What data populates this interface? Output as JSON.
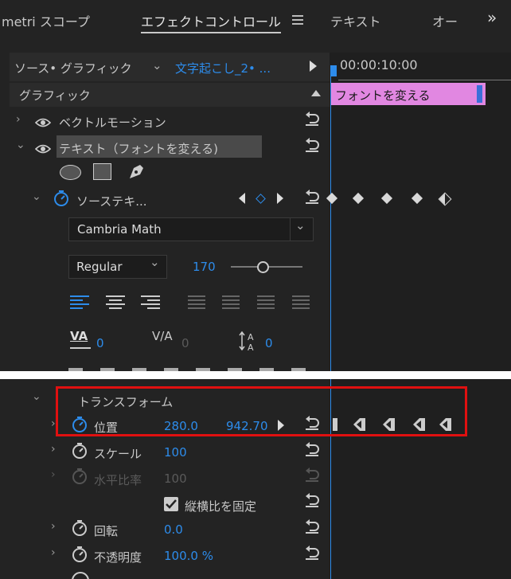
{
  "tabs": {
    "lumetri": "metri スコープ",
    "effect_controls": "エフェクトコントロール",
    "text": "テキスト",
    "other": "オー",
    "more": "»"
  },
  "source": {
    "label": "ソース• グラフィック",
    "clip": "文字起こし_2• ...",
    "timecode": "00:00:10:00",
    "clip_bar": "フォントを変える"
  },
  "section": {
    "graphic": "グラフィック"
  },
  "layers": {
    "vector_motion": "ベクトルモーション",
    "text_layer": "テキスト（フォントを変える)"
  },
  "source_text": {
    "label": "ソーステキ..."
  },
  "font": {
    "family": "Cambria Math",
    "style": "Regular",
    "size": "170"
  },
  "tracking": {
    "kerning": "0",
    "tracking": "0",
    "leading": "0",
    "kerning_icon_text": "VA",
    "tracking_icon_text": "V/A"
  },
  "transform": {
    "title": "トランスフォーム",
    "position": {
      "label": "位置",
      "x": "280.0",
      "y": "942.70"
    },
    "scale": {
      "label": "スケール",
      "value": "100"
    },
    "scale_h": {
      "label": "水平比率",
      "value": "100"
    },
    "uniform": {
      "label": "縦横比を固定",
      "checked": true
    },
    "rotation": {
      "label": "回転",
      "value": "0.0"
    },
    "opacity": {
      "label": "不透明度",
      "value": "100.0 %"
    }
  },
  "colors": {
    "panel_bg": "#232323",
    "accent_blue": "#2d8ceb",
    "clip_pink": "#e187e1",
    "highlight_red": "#e01010"
  },
  "icons": [
    "eye-icon",
    "stopwatch-icon",
    "reset-icon",
    "ellipse-tool-icon",
    "rectangle-tool-icon",
    "pen-tool-icon",
    "keyframe-icon",
    "checkbox-icon",
    "menu-icon",
    "align-left-icon",
    "align-center-icon",
    "align-right-icon",
    "justify-icon"
  ]
}
